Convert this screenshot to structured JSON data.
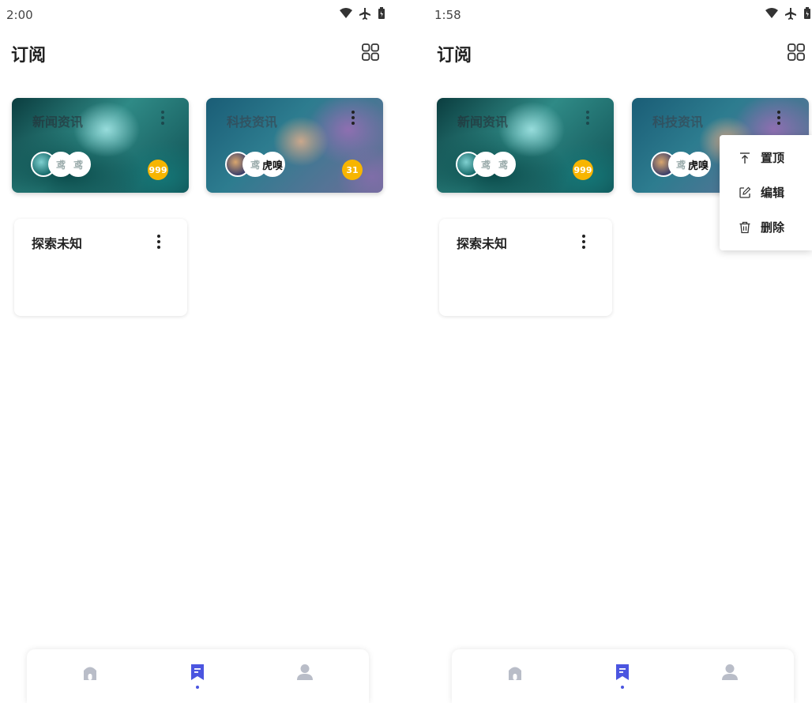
{
  "left": {
    "status_time": "2:00",
    "page_title": "订阅",
    "cards": [
      {
        "title": "新闻资讯",
        "badge": "999",
        "avatar_texts": [
          "",
          "鸢",
          "鸢"
        ]
      },
      {
        "title": "科技资讯",
        "badge": "31",
        "avatar_texts": [
          "",
          "鸢",
          "虎嗅"
        ]
      },
      {
        "title": "探索未知"
      }
    ]
  },
  "right": {
    "status_time": "1:58",
    "page_title": "订阅",
    "cards": [
      {
        "title": "新闻资讯",
        "badge": "999",
        "avatar_texts": [
          "",
          "鸢",
          "鸢"
        ]
      },
      {
        "title": "科技资讯",
        "avatar_texts": [
          "",
          "鸢",
          "虎嗅"
        ]
      },
      {
        "title": "探索未知"
      }
    ],
    "context_menu": {
      "pin_label": "置顶",
      "edit_label": "编辑",
      "delete_label": "删除"
    }
  },
  "nav": {
    "items": [
      "home-icon",
      "bookmark-icon",
      "person-icon"
    ],
    "active_index": 1,
    "active_color": "#4b55e0",
    "inactive_color": "#b9bdc8"
  },
  "colors": {
    "badge": "#f7b500",
    "accent": "#4b55e0"
  }
}
